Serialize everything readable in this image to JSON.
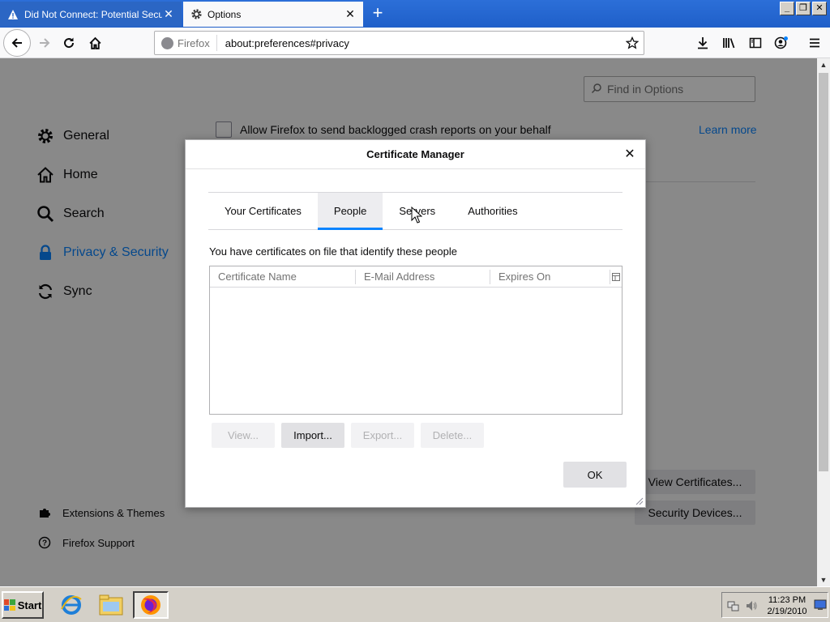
{
  "browser": {
    "tabs": [
      {
        "title": "Did Not Connect: Potential Securit",
        "icon": "warning-icon",
        "active": false
      },
      {
        "title": "Options",
        "icon": "gear-icon",
        "active": true
      }
    ],
    "url_identity": "Firefox",
    "url": "about:preferences#privacy"
  },
  "preferences": {
    "search_placeholder": "Find in Options",
    "categories": [
      {
        "label": "General",
        "icon": "gear-icon"
      },
      {
        "label": "Home",
        "icon": "home-icon"
      },
      {
        "label": "Search",
        "icon": "search-icon"
      },
      {
        "label": "Privacy & Security",
        "icon": "lock-icon",
        "selected": true
      },
      {
        "label": "Sync",
        "icon": "sync-icon"
      }
    ],
    "footer_links": [
      {
        "label": "Extensions & Themes",
        "icon": "puzzle-icon"
      },
      {
        "label": "Firefox Support",
        "icon": "help-icon"
      }
    ],
    "crash_reports_label": "Allow Firefox to send backlogged crash reports on your behalf",
    "learn_more": "Learn more",
    "view_certificates": "View Certificates...",
    "security_devices": "Security Devices..."
  },
  "dialog": {
    "title": "Certificate Manager",
    "tabs": [
      "Your Certificates",
      "People",
      "Servers",
      "Authorities"
    ],
    "selected_tab": "People",
    "description": "You have certificates on file that identify these people",
    "columns": [
      "Certificate Name",
      "E-Mail Address",
      "Expires On"
    ],
    "rows": [],
    "buttons": {
      "view": "View...",
      "import": "Import...",
      "export": "Export...",
      "delete": "Delete...",
      "ok": "OK"
    }
  },
  "taskbar": {
    "start_label": "Start",
    "time": "11:23 PM",
    "date": "2/19/2010"
  },
  "colors": {
    "accent": "#0a84ff",
    "titlebar": "#1f5fc9",
    "taskbar": "#d4d0c8"
  }
}
